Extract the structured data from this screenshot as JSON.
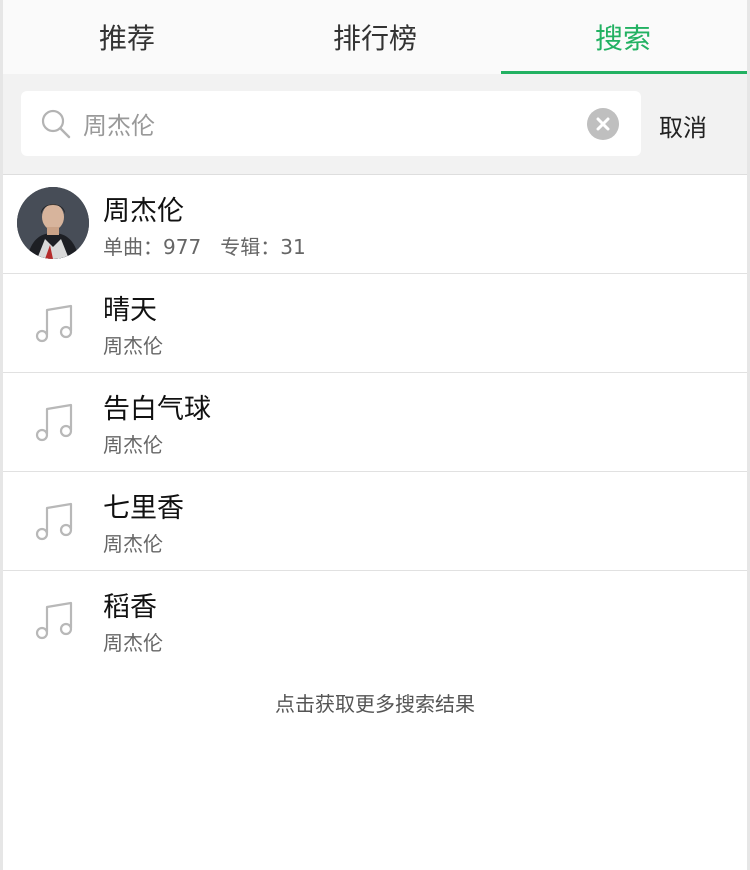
{
  "tabs": [
    {
      "label": "推荐"
    },
    {
      "label": "排行榜"
    },
    {
      "label": "搜索"
    }
  ],
  "active_tab": "搜索",
  "accent_color": "#22b162",
  "search": {
    "value": "周杰伦",
    "cancel_label": "取消",
    "icon": "search-icon",
    "clear_icon": "clear-icon"
  },
  "artist_result": {
    "name": "周杰伦",
    "stats": "单曲：977   专辑：31"
  },
  "songs": [
    {
      "title": "晴天",
      "artist": "周杰伦",
      "icon": "music-note-icon"
    },
    {
      "title": "告白气球",
      "artist": "周杰伦",
      "icon": "music-note-icon"
    },
    {
      "title": "七里香",
      "artist": "周杰伦",
      "icon": "music-note-icon"
    },
    {
      "title": "稻香",
      "artist": "周杰伦",
      "icon": "music-note-icon"
    }
  ],
  "more_label": "点击获取更多搜索结果"
}
